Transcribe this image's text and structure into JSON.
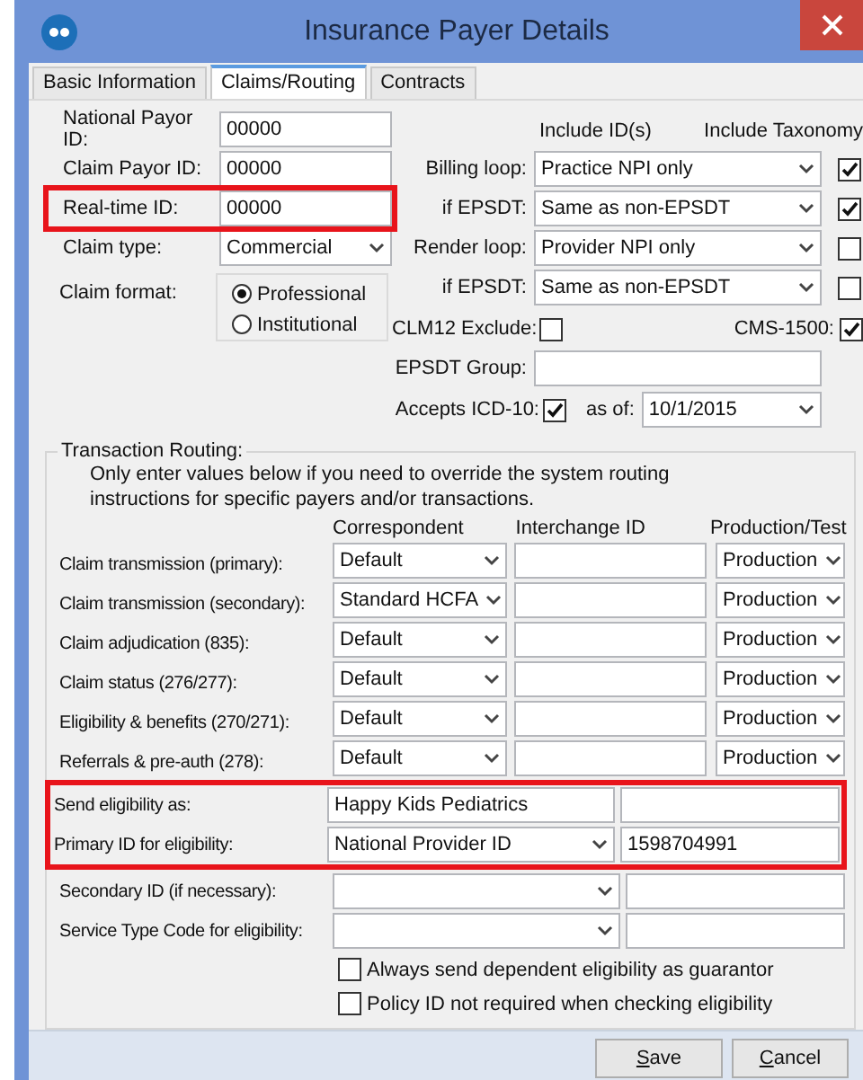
{
  "window": {
    "title": "Insurance Payer Details"
  },
  "tabs": [
    {
      "label": "Basic Information",
      "selected": false
    },
    {
      "label": "Claims/Routing",
      "selected": true
    },
    {
      "label": "Contracts",
      "selected": false
    }
  ],
  "payer_fields": [
    {
      "label": "National Payor ID:",
      "kind": "text",
      "value": "00000",
      "highlighted": false
    },
    {
      "label": "Claim Payor ID:",
      "kind": "text",
      "value": "00000",
      "highlighted": false
    },
    {
      "label": "Real-time ID:",
      "kind": "text",
      "value": "00000",
      "highlighted": true
    },
    {
      "label": "Claim type:",
      "kind": "select",
      "value": "Commercial",
      "highlighted": false
    }
  ],
  "claim_format": {
    "label": "Claim format:",
    "options": [
      {
        "label": "Professional",
        "selected": true
      },
      {
        "label": "Institutional",
        "selected": false
      }
    ]
  },
  "include_headers": {
    "ids": "Include ID(s)",
    "taxonomy": "Include Taxonomy"
  },
  "loops": [
    {
      "label": "Billing loop:",
      "value": "Practice NPI only",
      "taxonomy": true
    },
    {
      "label": "if EPSDT:",
      "value": "Same as non-EPSDT",
      "taxonomy": true
    },
    {
      "label": "Render loop:",
      "value": "Provider NPI only",
      "taxonomy": false
    },
    {
      "label": "if EPSDT:",
      "value": "Same as non-EPSDT",
      "taxonomy": false
    }
  ],
  "clm12": {
    "label": "CLM12 Exclude:",
    "checked": false
  },
  "cms1500": {
    "label": "CMS-1500:",
    "checked": true
  },
  "epsdt_group": {
    "label": "EPSDT Group:"
  },
  "icd10": {
    "label": "Accepts ICD-10:",
    "checked": true,
    "as_of_label": "as of:",
    "date": "10/1/2015"
  },
  "routing": {
    "title": "Transaction Routing:",
    "note": "Only enter values below if you need to override the system routing instructions for specific payers and/or transactions.",
    "columns": [
      "Correspondent",
      "Interchange ID",
      "Production/Test"
    ],
    "rows": [
      {
        "label": "Claim transmission (primary):",
        "correspondent": "Default",
        "mode": "Production"
      },
      {
        "label": "Claim transmission (secondary):",
        "correspondent": "Standard HCFA",
        "mode": "Production"
      },
      {
        "label": "Claim adjudication (835):",
        "correspondent": "Default",
        "mode": "Production"
      },
      {
        "label": "Claim status (276/277):",
        "correspondent": "Default",
        "mode": "Production"
      },
      {
        "label": "Eligibility & benefits (270/271):",
        "correspondent": "Default",
        "mode": "Production"
      },
      {
        "label": "Referrals & pre-auth (278):",
        "correspondent": "Default",
        "mode": "Production"
      }
    ]
  },
  "eligibility": [
    {
      "label": "Send eligibility as:",
      "kind": "text",
      "value": "Happy Kids Pediatrics",
      "highlighted": true
    },
    {
      "label": "Primary ID for eligibility:",
      "kind": "select",
      "value": "National Provider ID",
      "id": "1598704991",
      "highlighted": true
    },
    {
      "label": "Secondary ID (if necessary):",
      "kind": "select",
      "highlighted": false
    },
    {
      "label": "Service Type Code for eligibility:",
      "kind": "select",
      "highlighted": false
    }
  ],
  "options": [
    {
      "label": "Always send dependent eligibility as guarantor",
      "checked": false
    },
    {
      "label": "Policy ID not required when checking eligibility",
      "checked": false
    }
  ],
  "buttons": [
    "Save",
    "Cancel"
  ]
}
